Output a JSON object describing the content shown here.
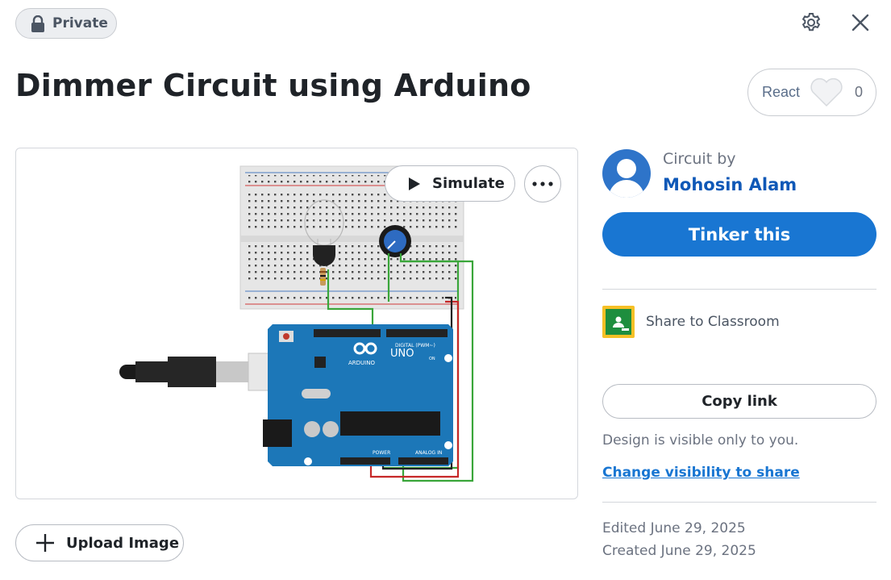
{
  "header": {
    "privacy_badge": "Private",
    "settings_icon": "gear-icon",
    "close_icon": "close-icon"
  },
  "design": {
    "title": "Dimmer Circuit using Arduino"
  },
  "react": {
    "label": "React",
    "count": "0",
    "icon": "heart-icon"
  },
  "preview": {
    "simulate_label": "Simulate",
    "more_icon": "more-options-icon",
    "board_texts": {
      "uno": "UNO",
      "brand": "ARDUINO",
      "digital": "DIGITAL (PWM~)",
      "power": "POWER",
      "analog": "ANALOG IN",
      "on": "ON"
    }
  },
  "upload": {
    "label": "Upload Image"
  },
  "author": {
    "prefix": "Circuit by",
    "name": "Mohosin Alam"
  },
  "actions": {
    "tinker_label": "Tinker this",
    "share_classroom_label": "Share to Classroom",
    "copy_link_label": "Copy link"
  },
  "visibility": {
    "note": "Design is visible only to you.",
    "change_link": "Change visibility to share"
  },
  "dates": {
    "edited": "Edited June 29, 2025",
    "created": "Created June 29, 2025"
  },
  "colors": {
    "primary_blue": "#1976d2",
    "author_link": "#0f58b7",
    "arduino_board": "#1c77b8",
    "classroom_green": "#1e8e3e",
    "classroom_yellow": "#f6c026"
  }
}
